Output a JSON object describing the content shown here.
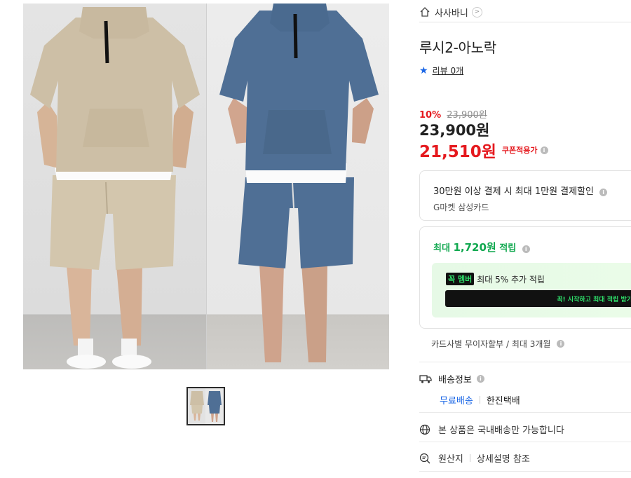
{
  "product": {
    "shop_name": "사사바니",
    "shop_arrow": ">",
    "title": "루시2-아노락",
    "review_text": "리뷰 0개",
    "discount_rate": "10%",
    "original_price": "23,900원",
    "price": "23,900원",
    "coupon_price": "21,510원",
    "coupon_label": "쿠폰적용가"
  },
  "card_promo": {
    "main": "30만원 이상 결제 시 최대 1만원 결제할인",
    "sub": "G마켓 삼성카드"
  },
  "points": {
    "prefix": "최대 ",
    "amount": "1,720원",
    "suffix": " 적립",
    "member_badge_a": "꼭",
    "member_badge_b": "멤버",
    "member_text": "최대 5% 추가 적립",
    "member_cta": "꼭! 시작하고 최대 적립 받기"
  },
  "installment": "카드사별 무이자할부 / 최대 3개월",
  "shipping": {
    "title": "배송정보",
    "free": "무료배송",
    "courier": "한진택배"
  },
  "domestic_note": "본 상품은 국내배송만 가능합니다",
  "origin": {
    "label": "원산지",
    "value": "상세설명 참조"
  },
  "icons": [
    "home-icon",
    "chevron-right-icon",
    "star-icon",
    "info-icon",
    "truck-icon",
    "globe-icon",
    "search-doc-icon"
  ],
  "colors": {
    "accent_red": "#e5191e",
    "point_green": "#10a84f",
    "link_blue": "#1a66e6",
    "member_green": "#2fe06b",
    "beige_outfit": "#cdbfa6",
    "blue_outfit": "#4f6f95"
  }
}
